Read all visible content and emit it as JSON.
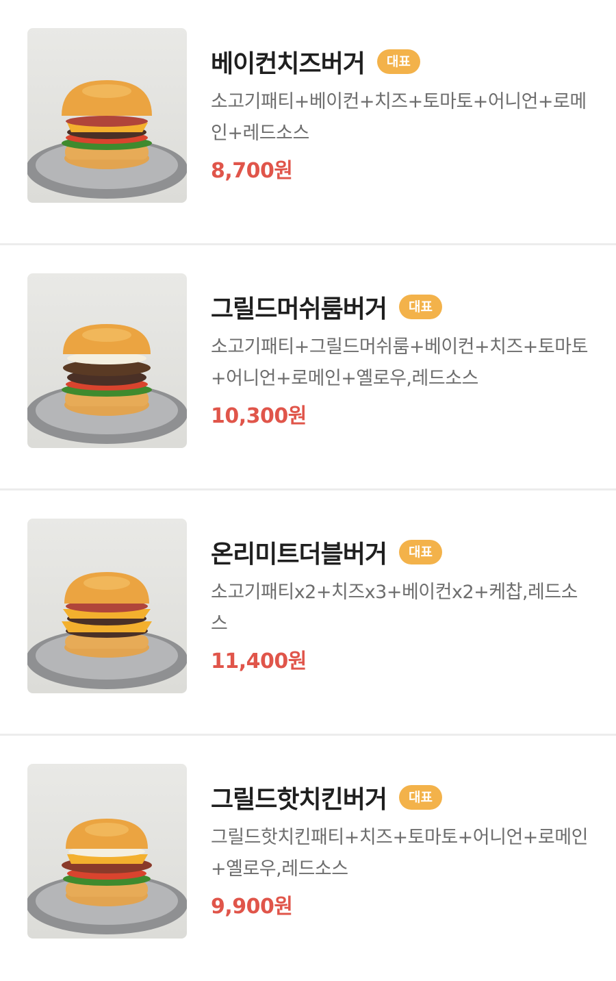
{
  "colors": {
    "badge": "#f3b24a",
    "price": "#e0554a",
    "divider": "#ececec"
  },
  "menu": [
    {
      "name": "베이컨치즈버거",
      "badge": "대표",
      "description": "소고기패티+베이컨+치즈+토마토+어니언+로메인+레드소스",
      "price": "8,700원",
      "image": "burger-photo"
    },
    {
      "name": "그릴드머쉬룸버거",
      "badge": "대표",
      "description": "소고기패티+그릴드머쉬룸+베이컨+치즈+토마토+어니언+로메인+옐로우,레드소스",
      "price": "10,300원",
      "image": "burger-photo"
    },
    {
      "name": "온리미트더블버거",
      "badge": "대표",
      "description": "소고기패티x2+치즈x3+베이컨x2+케찹,레드소스",
      "price": "11,400원",
      "image": "burger-photo"
    },
    {
      "name": "그릴드핫치킨버거",
      "badge": "대표",
      "description": "그릴드핫치킨패티+치즈+토마토+어니언+로메인+옐로우,레드소스",
      "price": "9,900원",
      "image": "burger-photo"
    }
  ]
}
